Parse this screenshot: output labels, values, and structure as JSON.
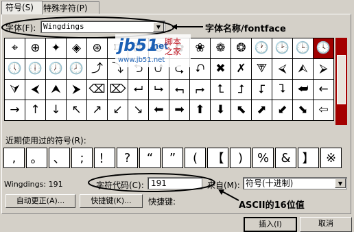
{
  "tabs": [
    {
      "label": "符号(S)"
    },
    {
      "label": "特殊字符(P)"
    }
  ],
  "font": {
    "label": "字体(F):",
    "value": "Wingdings",
    "annotation": "字体名称/fontface"
  },
  "watermark": {
    "brand": "jb51",
    "brand_suffix": ".net",
    "text_a": "脚本",
    "text_b": "之家",
    "url": "www.jb51.net"
  },
  "symbols": [
    "⌖",
    "⊕",
    "✦",
    "◈",
    "⊛",
    "⌑",
    "⌘",
    "⦾",
    "✿",
    "❀",
    "❁",
    "❂",
    "🕐",
    "🕑",
    "🕒",
    "🕓",
    "🕔",
    "🕕",
    "🕖",
    "🕗",
    "⤴",
    "⤵",
    "⮌",
    "⮍",
    "⮎",
    "⮏",
    "✖",
    "✗",
    "⮗",
    "⮘",
    "⮙",
    "⮚",
    "⮛",
    "⮜",
    "⮝",
    "⮞",
    "⌫",
    "⌦",
    "⮠",
    "⮡",
    "⮢",
    "⮣",
    "⮤",
    "⮥",
    "⮦",
    "⮧",
    "⮨",
    "←",
    "→",
    "↑",
    "↓",
    "↖",
    "↗",
    "↙",
    "↘",
    "⬅",
    "➡",
    "⬆",
    "⬇",
    "⬉",
    "⬈",
    "⬋",
    "⬊",
    "⇦"
  ],
  "selected_index": 15,
  "recent": {
    "label": "近期使用过的符号(R):",
    "items": [
      ",",
      "。",
      "、",
      ";",
      "！",
      "?",
      "“",
      "”",
      "(",
      "【",
      ")",
      "%",
      "&",
      "】",
      "※"
    ]
  },
  "footer": {
    "font_name": "Wingdings: 191",
    "charcode_label": "字符代码(C):",
    "charcode_value": "191",
    "from_label": "来自(M):",
    "from_value": "符号(十进制)",
    "autocorrect_button": "自动更正(A)...",
    "shortcut_button": "快捷键(K)...",
    "shortcut_label": "快捷键:",
    "ascii_annotation": "ASCII的16位值",
    "insert_button": "插入(I)",
    "cancel_button": "取消"
  }
}
